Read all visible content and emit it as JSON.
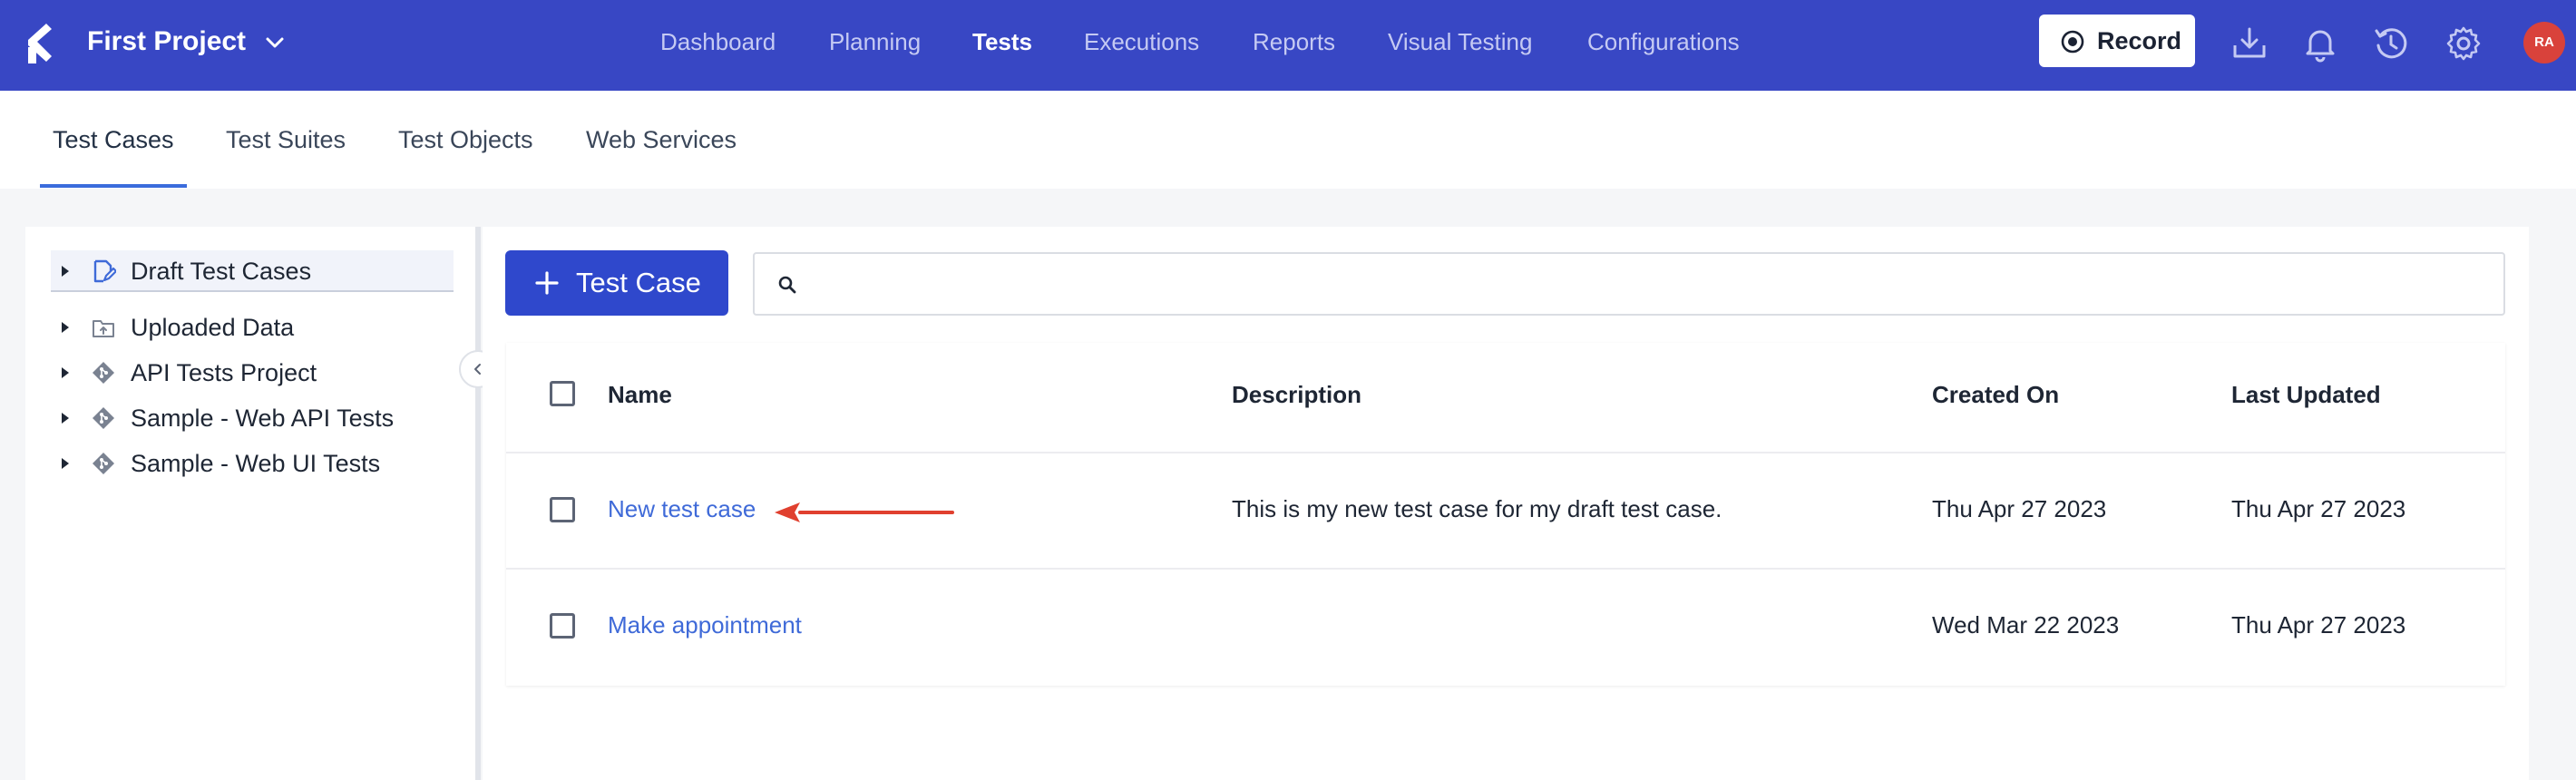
{
  "header": {
    "project_name": "First Project",
    "nav": [
      "Dashboard",
      "Planning",
      "Tests",
      "Executions",
      "Reports",
      "Visual Testing",
      "Configurations"
    ],
    "active_nav": "Tests",
    "record_label": "Record",
    "avatar_initials": "RA",
    "colors": {
      "bar": "#3847c4",
      "record_icon": "#1b2233"
    }
  },
  "subtabs": {
    "items": [
      "Test Cases",
      "Test Suites",
      "Test Objects",
      "Web Services"
    ],
    "active": "Test Cases"
  },
  "tree": {
    "items": [
      {
        "label": "Draft Test Cases",
        "icon": "draft-icon",
        "selected": true
      },
      {
        "label": "Uploaded Data",
        "icon": "upload-folder-icon",
        "selected": false
      },
      {
        "label": "API Tests Project",
        "icon": "git-icon",
        "selected": false
      },
      {
        "label": "Sample - Web API Tests",
        "icon": "git-icon",
        "selected": false
      },
      {
        "label": "Sample - Web UI Tests",
        "icon": "git-icon",
        "selected": false
      }
    ]
  },
  "main": {
    "add_button_label": "Test Case",
    "search": {
      "value": "",
      "placeholder": ""
    },
    "table": {
      "columns": [
        "Name",
        "Description",
        "Created On",
        "Last Updated"
      ],
      "rows": [
        {
          "name": "New test case",
          "description": "This is my new test case for my draft test case.",
          "created_on": "Thu Apr 27 2023",
          "last_updated": "Thu Apr 27 2023"
        },
        {
          "name": "Make appointment",
          "description": "",
          "created_on": "Wed Mar 22 2023",
          "last_updated": "Thu Apr 27 2023"
        }
      ]
    },
    "annotation_arrow_color": "#e0402f",
    "link_color": "#3f6ad8"
  }
}
